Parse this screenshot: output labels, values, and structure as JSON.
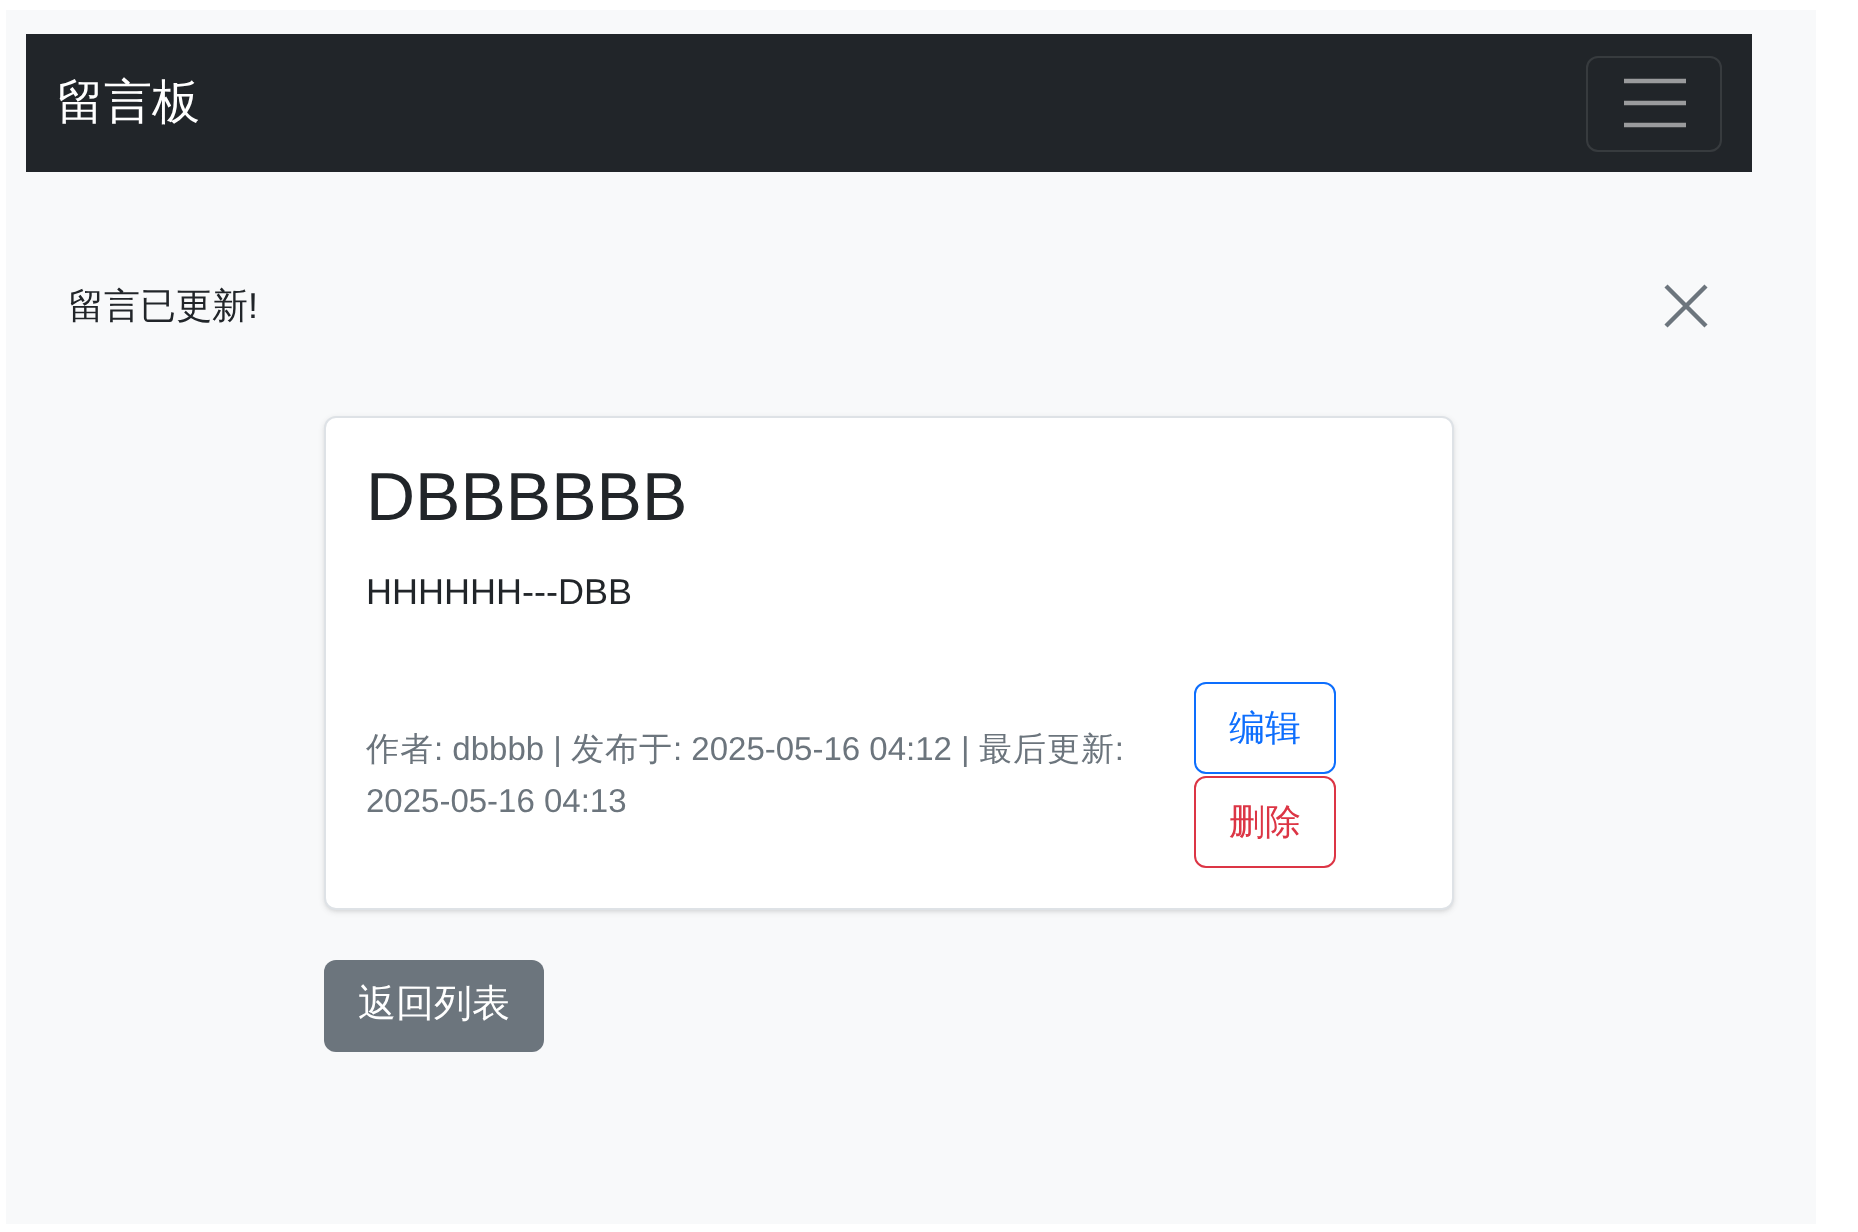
{
  "navbar": {
    "brand": "留言板"
  },
  "alert": {
    "message": "留言已更新!"
  },
  "post": {
    "title": "DBBBBBB",
    "content": "HHHHHH---DBB",
    "meta": "作者: dbbbb | 发布于: 2025-05-16 04:12 | 最后更新: 2025-05-16 04:13",
    "actions": [
      {
        "label": "编辑",
        "kind": "edit"
      },
      {
        "label": "删除",
        "kind": "delete"
      }
    ]
  },
  "back_button": {
    "label": "返回列表"
  }
}
